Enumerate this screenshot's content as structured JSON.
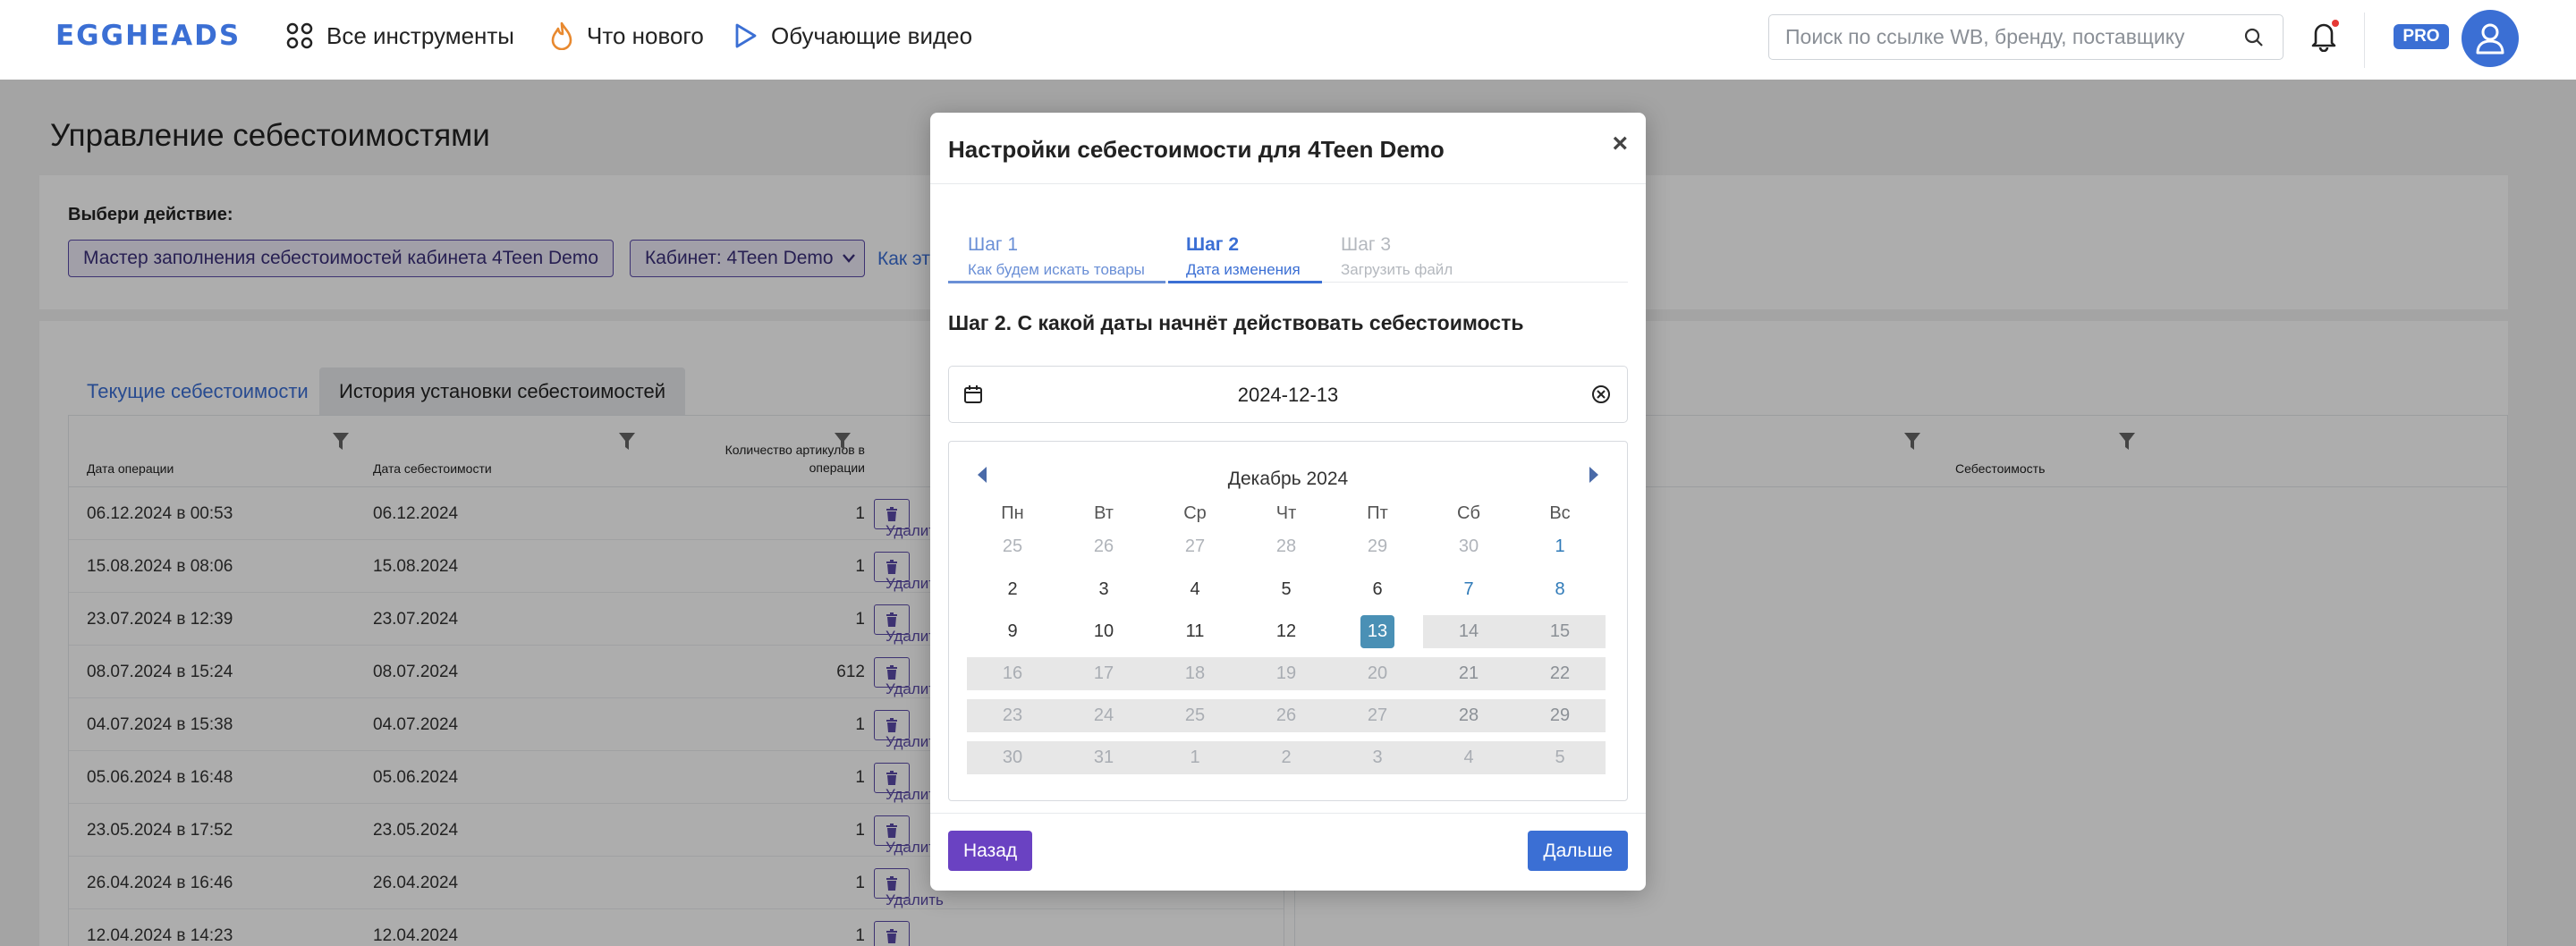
{
  "header": {
    "logo": "EGGHEADS",
    "nav": [
      {
        "label": "Все инструменты",
        "icon": "grid-icon"
      },
      {
        "label": "Что нового",
        "icon": "fire-icon"
      },
      {
        "label": "Обучающие видео",
        "icon": "play-icon"
      }
    ],
    "search_placeholder": "Поиск по ссылке WB, бренду, поставщику",
    "pro_badge": "PRO"
  },
  "page": {
    "title": "Управление себестоимостями",
    "action_label": "Выбери действие:",
    "wizard_button": "Мастер заполнения себестоимостей кабинета 4Teen Demo",
    "cabinet_select": "Кабинет: 4Teen Demo",
    "how_link": "Как эт",
    "tabs": [
      {
        "label": "Текущие себестоимости",
        "active": false
      },
      {
        "label": "История установки себестоимостей",
        "active": true
      }
    ],
    "table": {
      "headers": [
        "Дата операции",
        "Дата себестоимости",
        "Количество артикулов в",
        "операции"
      ],
      "delete_label": "Удалить",
      "rows": [
        {
          "op": "06.12.2024 в 00:53",
          "cost_date": "06.12.2024",
          "count": "1"
        },
        {
          "op": "15.08.2024 в 08:06",
          "cost_date": "15.08.2024",
          "count": "1"
        },
        {
          "op": "23.07.2024 в 12:39",
          "cost_date": "23.07.2024",
          "count": "1"
        },
        {
          "op": "08.07.2024 в 15:24",
          "cost_date": "08.07.2024",
          "count": "612"
        },
        {
          "op": "04.07.2024 в 15:38",
          "cost_date": "04.07.2024",
          "count": "1"
        },
        {
          "op": "05.06.2024 в 16:48",
          "cost_date": "05.06.2024",
          "count": "1"
        },
        {
          "op": "23.05.2024 в 17:52",
          "cost_date": "23.05.2024",
          "count": "1"
        },
        {
          "op": "26.04.2024 в 16:46",
          "cost_date": "26.04.2024",
          "count": "1"
        },
        {
          "op": "12.04.2024 в 14:23",
          "cost_date": "12.04.2024",
          "count": "1"
        }
      ]
    },
    "table2": {
      "header": "Себестоимость"
    }
  },
  "modal": {
    "title": "Настройки себестоимости для 4Teen Demo",
    "close": "×",
    "steps": [
      {
        "title": "Шаг 1",
        "subtitle": "Как будем искать товары"
      },
      {
        "title": "Шаг 2",
        "subtitle": "Дата изменения"
      },
      {
        "title": "Шаг 3",
        "subtitle": "Загрузить файл"
      }
    ],
    "active_step": 2,
    "question": "Шаг 2. С какой даты начнёт действовать себестоимость",
    "date_value": "2024-12-13",
    "calendar": {
      "month": "Декабрь 2024",
      "weekdays": [
        "Пн",
        "Вт",
        "Ср",
        "Чт",
        "Пт",
        "Сб",
        "Вс"
      ],
      "weeks": [
        [
          "25",
          "26",
          "27",
          "28",
          "29",
          "30",
          "1"
        ],
        [
          "2",
          "3",
          "4",
          "5",
          "6",
          "7",
          "8"
        ],
        [
          "9",
          "10",
          "11",
          "12",
          "13",
          "14",
          "15"
        ],
        [
          "16",
          "17",
          "18",
          "19",
          "20",
          "21",
          "22"
        ],
        [
          "23",
          "24",
          "25",
          "26",
          "27",
          "28",
          "29"
        ],
        [
          "30",
          "31",
          "1",
          "2",
          "3",
          "4",
          "5"
        ]
      ],
      "selected": "13"
    },
    "back_button": "Назад",
    "next_button": "Дальше"
  },
  "colors": {
    "accent": "#3b6fd4",
    "purple": "#6a42c2",
    "selected_day": "#4a90b5"
  }
}
